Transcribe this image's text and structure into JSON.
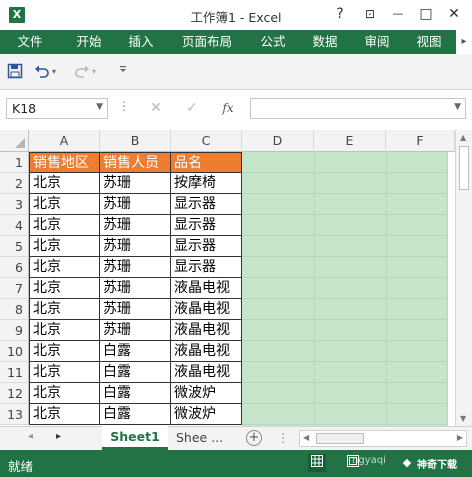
{
  "window": {
    "title": "工作簿1 - Excel",
    "app_icon_letter": "X",
    "controls": {
      "help": "?",
      "ribbon_options": "⊡",
      "minimize": "—",
      "restore": "□",
      "close": "✕"
    }
  },
  "ribbon": {
    "tabs": [
      {
        "label": "文件",
        "active": true
      },
      {
        "label": "开始"
      },
      {
        "label": "插入"
      },
      {
        "label": "页面布局"
      },
      {
        "label": "公式"
      },
      {
        "label": "数据"
      },
      {
        "label": "审阅"
      },
      {
        "label": "视图"
      }
    ],
    "scroll_right": "▸"
  },
  "qat": {
    "save_icon": "save-icon",
    "undo_icon": "undo-icon",
    "redo_icon": "redo-icon",
    "customize_icon": "customize-icon"
  },
  "formula_bar": {
    "name_box": "K18",
    "dots": "⋮",
    "cancel": "✕",
    "enter": "✓",
    "fx": "fx",
    "formula": ""
  },
  "sheet": {
    "columns": [
      "A",
      "B",
      "C",
      "D",
      "E",
      "F"
    ],
    "rows": [
      "1",
      "2",
      "3",
      "4",
      "5",
      "6",
      "7",
      "8",
      "9",
      "10",
      "11",
      "12",
      "13"
    ],
    "header_row": [
      "销售地区",
      "销售人员",
      "品名"
    ],
    "data": [
      [
        "北京",
        "苏珊",
        "按摩椅"
      ],
      [
        "北京",
        "苏珊",
        "显示器"
      ],
      [
        "北京",
        "苏珊",
        "显示器"
      ],
      [
        "北京",
        "苏珊",
        "显示器"
      ],
      [
        "北京",
        "苏珊",
        "显示器"
      ],
      [
        "北京",
        "苏珊",
        "液晶电视"
      ],
      [
        "北京",
        "苏珊",
        "液晶电视"
      ],
      [
        "北京",
        "苏珊",
        "液晶电视"
      ],
      [
        "北京",
        "白露",
        "液晶电视"
      ],
      [
        "北京",
        "白露",
        "液晶电视"
      ],
      [
        "北京",
        "白露",
        "微波炉"
      ],
      [
        "北京",
        "白露",
        "微波炉"
      ]
    ],
    "header_fill": "#ed7d31",
    "highlight_fill": "#c6e6cc"
  },
  "sheet_tabs": {
    "prev": "◂",
    "next": "▸",
    "tabs": [
      "Sheet1",
      "Shee ..."
    ],
    "add": "+",
    "dots": "⋮"
  },
  "status_bar": {
    "status": "就绪",
    "watermark": "ngyaqi",
    "brand": "神奇下载"
  },
  "colors": {
    "brand_green": "#217346"
  }
}
